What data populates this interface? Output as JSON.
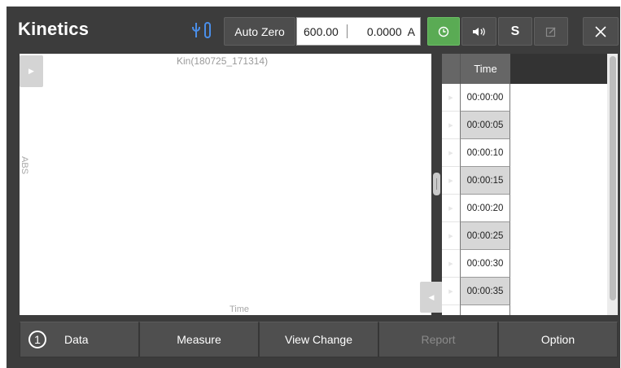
{
  "app": {
    "title": "Kinetics"
  },
  "header": {
    "auto_zero_label": "Auto Zero",
    "wavelength": "600.00",
    "absorbance_value": "0.0000",
    "absorbance_unit": "A",
    "s_label": "S",
    "icons": [
      "usb-icon",
      "timer-icon",
      "speaker-icon",
      "edit-icon",
      "close-icon"
    ]
  },
  "graph": {
    "title": "Kin(180725_171314)",
    "ylabel": "ABS",
    "xlabel": "Time"
  },
  "table": {
    "header": "Time",
    "rows": [
      "00:00:00",
      "00:00:05",
      "00:00:10",
      "00:00:15",
      "00:00:20",
      "00:00:25",
      "00:00:30",
      "00:00:35"
    ]
  },
  "footer": {
    "data_number": "1",
    "data_label": "Data",
    "measure_label": "Measure",
    "view_change_label": "View Change",
    "report_label": "Report",
    "option_label": "Option"
  },
  "colors": {
    "background": "#3c3c3c",
    "accent_green": "#5aab54",
    "usb_blue": "#4a8ee8"
  }
}
